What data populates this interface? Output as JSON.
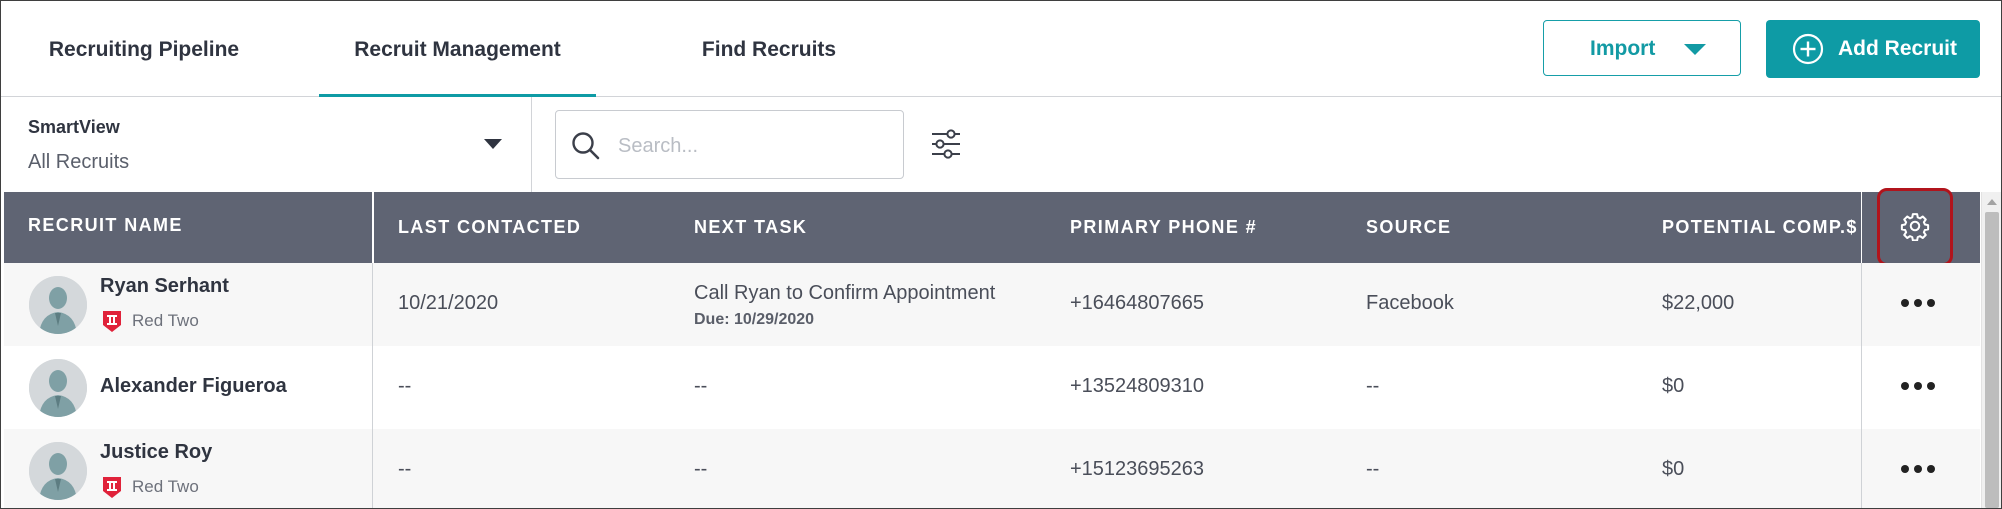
{
  "nav": {
    "tabs": [
      {
        "label": "Recruiting Pipeline",
        "active": false
      },
      {
        "label": "Recruit Management",
        "active": true
      },
      {
        "label": "Find Recruits",
        "active": false
      }
    ],
    "import_label": "Import",
    "add_label": "Add Recruit"
  },
  "smartview": {
    "title": "SmartView",
    "selected": "All Recruits"
  },
  "search": {
    "placeholder": "Search..."
  },
  "table": {
    "columns": [
      "RECRUIT NAME",
      "LAST CONTACTED",
      "NEXT TASK",
      "PRIMARY PHONE #",
      "SOURCE",
      "POTENTIAL COMP.$"
    ],
    "rows": [
      {
        "name": "Ryan Serhant",
        "team": "Red Two",
        "last_contacted": "10/21/2020",
        "next_task": "Call Ryan to Confirm Appointment",
        "due": "Due: 10/29/2020",
        "phone": "+16464807665",
        "source": "Facebook",
        "comp": "$22,000"
      },
      {
        "name": "Alexander Figueroa",
        "team": "",
        "last_contacted": "--",
        "next_task": "--",
        "due": "",
        "phone": "+13524809310",
        "source": "--",
        "comp": "$0"
      },
      {
        "name": "Justice Roy",
        "team": "Red Two",
        "last_contacted": "--",
        "next_task": "--",
        "due": "",
        "phone": "+15123695263",
        "source": "--",
        "comp": "$0"
      }
    ]
  },
  "icons": {
    "settings": "gear-icon",
    "more": "more-options-icon",
    "filter": "filter-sliders-icon",
    "search": "search-icon",
    "team": "team-badge-icon"
  },
  "colors": {
    "accent": "#0e9ba5",
    "header_bg": "#5f6473",
    "highlight": "#b1141c",
    "team_badge": "#e0223a"
  }
}
